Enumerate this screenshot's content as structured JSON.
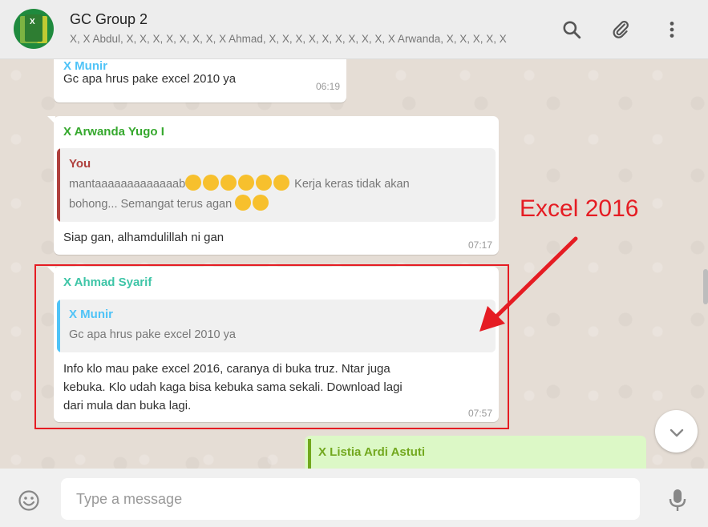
{
  "header": {
    "title": "GC Group 2",
    "participants": "X, X Abdul, X, X, X, X, X, X, X, X Ahmad, X, X, X, X, X, X, X, X, X, X Arwanda, X, X, X, X, X",
    "avatar_label": "X",
    "icons": [
      "search-icon",
      "paperclip-icon",
      "menu-dots-icon"
    ]
  },
  "messages": [
    {
      "sender": "X Munir",
      "sender_color": "#4fc3f7",
      "text": "Gc apa hrus pake excel 2010 ya",
      "time": "06:19"
    },
    {
      "sender": "X Arwanda Yugo I",
      "sender_color": "#35a82d",
      "quote": {
        "name": "You",
        "name_color": "#b0413e",
        "bar_color": "#b0413e",
        "line1": "mantaaaaaaaaaaaaab",
        "line1_rest": "Kerja keras tidak akan",
        "line2": "bohong... Semangat terus agan"
      },
      "text": "Siap gan, alhamdulillah ni gan",
      "time": "07:17"
    },
    {
      "sender": "X Ahmad Syarif",
      "sender_color": "#3ec5a7",
      "quote": {
        "name": "X Munir",
        "name_color": "#4fc3f7",
        "bar_color": "#4fc3f7",
        "text": "Gc apa hrus pake excel 2010 ya"
      },
      "lines": [
        "Info klo mau pake excel 2016, caranya di buka truz.  Ntar juga",
        "kebuka.  Klo udah kaga bisa kebuka sama sekali.  Download lagi",
        "dari mula dan buka lagi."
      ],
      "time": "07:57"
    },
    {
      "sender": "X Listia Ardi Astuti",
      "sender_color": "#72a81e"
    }
  ],
  "annotation": {
    "label": "Excel 2016",
    "color": "#e51c23"
  },
  "composer": {
    "placeholder": "Type a message"
  },
  "footer_icons": [
    "emoji-icon",
    "mic-icon"
  ]
}
